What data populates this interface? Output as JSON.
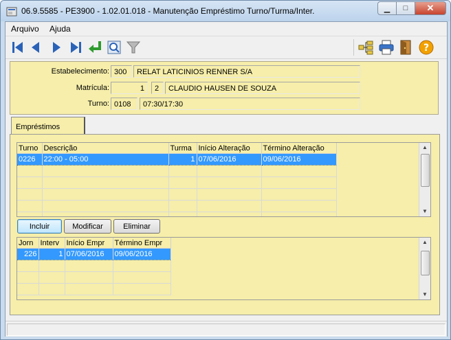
{
  "window": {
    "title": "06.9.5585 - PE3900 - 1.02.01.018 - Manutenção Empréstimo Turno/Turma/Inter.",
    "minimize_icon": "minimize-icon",
    "maximize_icon": "maximize-icon",
    "close_icon": "close-icon"
  },
  "menu": [
    {
      "label": "Arquivo"
    },
    {
      "label": "Ajuda"
    }
  ],
  "toolbar": {
    "icons": [
      "first-record-icon",
      "previous-record-icon",
      "next-record-icon",
      "last-record-icon",
      "return-icon",
      "search-icon",
      "filter-icon",
      "hierarchy-icon",
      "print-icon",
      "exit-icon",
      "help-icon"
    ],
    "colors": {
      "nav": "#2a62b8",
      "return": "#2e9b2e",
      "help": "#f2a100"
    }
  },
  "header": {
    "estabelecimento": {
      "label": "Estabelecimento:",
      "code": "300",
      "name": "RELAT LATICINIOS RENNER S/A"
    },
    "matricula": {
      "label": "Matrícula:",
      "number": "1",
      "digit": "2",
      "name": "CLAUDIO HAUSEN DE SOUZA"
    },
    "turno": {
      "label": "Turno:",
      "code": "0108",
      "hours": "07:30/17:30"
    }
  },
  "tab": {
    "label": "Empréstimos"
  },
  "grid1": {
    "columns": [
      "Turno",
      "Descrição",
      "Turma",
      "Início Alteração",
      "Término Alteração"
    ],
    "rows": [
      [
        "0226",
        "22:00 - 05:00",
        "1",
        "07/06/2016",
        "09/06/2016"
      ]
    ],
    "empty_rows": 5
  },
  "buttons": {
    "incluir": "Incluir",
    "modificar": "Modificar",
    "eliminar": "Eliminar"
  },
  "grid2": {
    "columns": [
      "Jorn",
      "Interv",
      "Início Empr",
      "Término Empr"
    ],
    "rows": [
      [
        "226",
        "1",
        "07/06/2016",
        "09/06/2016"
      ]
    ],
    "empty_rows": 3
  },
  "colors": {
    "panel": "#f6eeaa",
    "selection": "#3399ff"
  }
}
